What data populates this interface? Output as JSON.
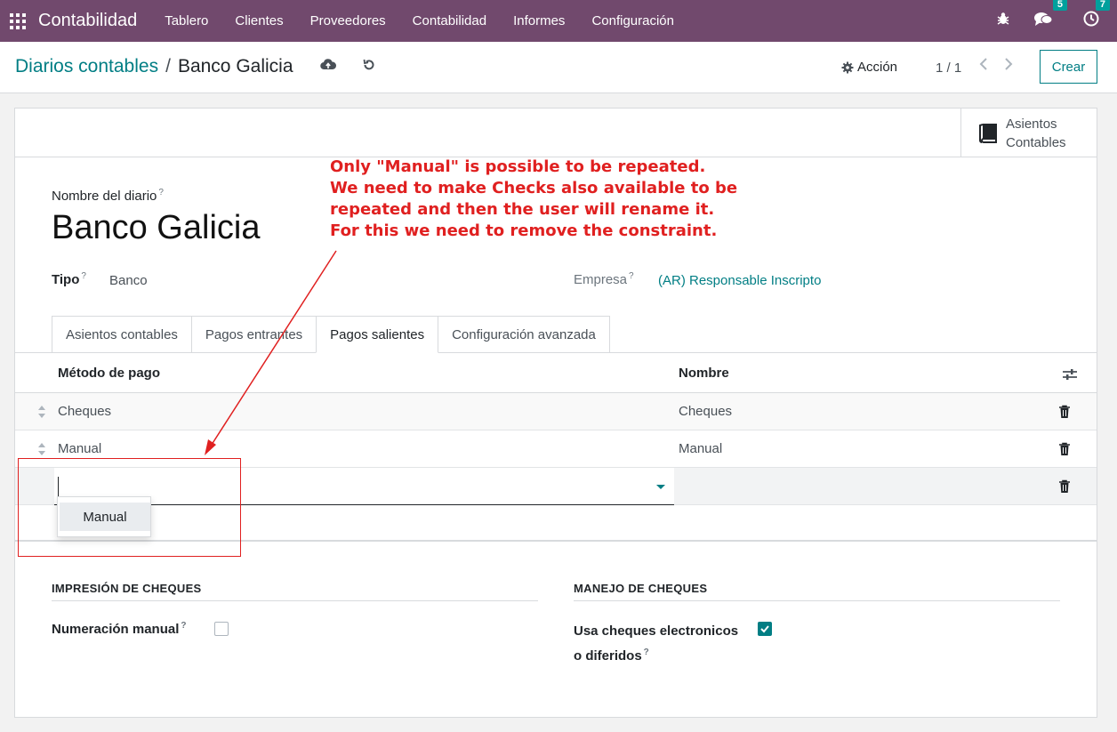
{
  "navbar": {
    "app_name": "Contabilidad",
    "menu": [
      "Tablero",
      "Clientes",
      "Proveedores",
      "Contabilidad",
      "Informes",
      "Configuración"
    ],
    "messages_badge": "5",
    "activities_badge": "7",
    "bg_color": "#71496d"
  },
  "control_panel": {
    "breadcrumb_parent": "Diarios contables",
    "breadcrumb_separator": "/",
    "breadcrumb_current": "Banco Galicia",
    "action_label": "Acción",
    "pager": "1 / 1",
    "create_label": "Crear"
  },
  "smart_button": {
    "label": "Asientos Contables",
    "icon": "book-icon"
  },
  "form": {
    "name_label": "Nombre del diario",
    "name_value": "Banco Galicia",
    "type_label": "Tipo",
    "type_value": "Banco",
    "company_label": "Empresa",
    "company_value": "(AR) Responsable Inscripto",
    "help_mark": "?"
  },
  "tabs": [
    {
      "label": "Asientos contables",
      "active": false
    },
    {
      "label": "Pagos entrantes",
      "active": false
    },
    {
      "label": "Pagos salientes",
      "active": true
    },
    {
      "label": "Configuración avanzada",
      "active": false
    }
  ],
  "payment_table": {
    "columns": [
      "Método de pago",
      "Nombre"
    ],
    "rows": [
      {
        "method": "Cheques",
        "name": "Cheques"
      },
      {
        "method": "Manual",
        "name": "Manual"
      }
    ],
    "edit_row_value": "",
    "dropdown_options": [
      "Manual"
    ]
  },
  "check_printing": {
    "section_title": "IMPRESIÓN DE CHEQUES",
    "manual_numbering_label": "Numeración manual",
    "manual_numbering_checked": false
  },
  "check_handling": {
    "section_title": "MANEJO DE CHEQUES",
    "electronic_label_line1": "Usa cheques electronicos",
    "electronic_label_line2": "o diferidos",
    "electronic_checked": true
  },
  "annotation": {
    "lines": [
      "Only \"Manual\" is possible to be repeated.",
      "We need to make Checks also available to be",
      "repeated and then the user will rename it.",
      "For this we need to remove the constraint."
    ],
    "color": "#e02020"
  },
  "colors": {
    "accent": "#017e84"
  }
}
